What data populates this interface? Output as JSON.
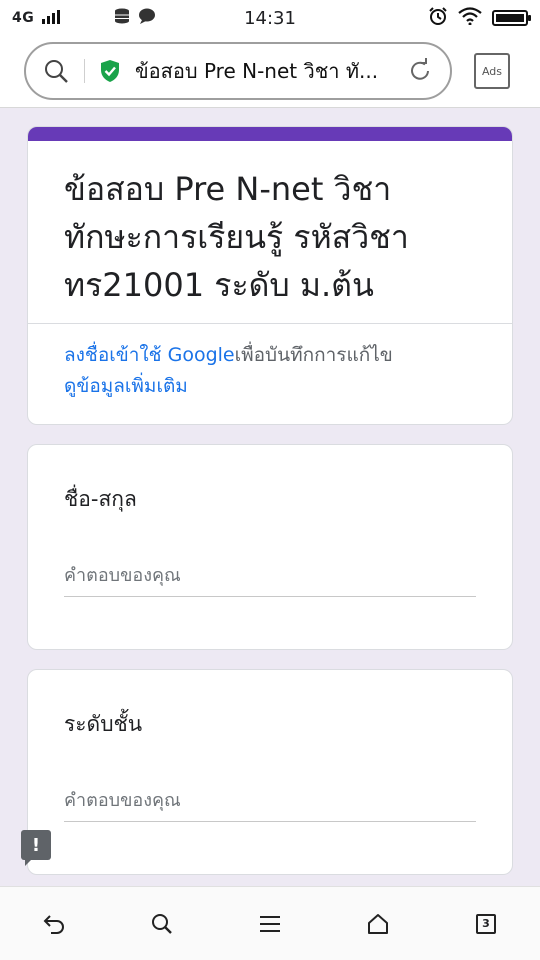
{
  "status_bar": {
    "network": "4G",
    "time": "14:31"
  },
  "browser": {
    "url_title": "ข้อสอบ Pre N-net วิชา ทั...",
    "ads_label": "Ads"
  },
  "form": {
    "title": "ข้อสอบ Pre N-net วิชา ทักษะการเรียนรู้ รหัสวิชา ทร21001 ระดับ ม.ต้น",
    "signin_link": "ลงชื่อเข้าใช้ Google",
    "signin_suffix": "เพื่อบันทึกการแก้ไข",
    "learn_more": "ดูข้อมูลเพิ่มเติม",
    "accent_color": "#673ab7"
  },
  "questions": [
    {
      "label": "ชื่อ-สกุล",
      "placeholder": "คำตอบของคุณ"
    },
    {
      "label": "ระดับชั้น",
      "placeholder": "คำตอบของคุณ"
    }
  ],
  "report": {
    "symbol": "!"
  },
  "bottom_nav": {
    "tabs_count": "3"
  }
}
